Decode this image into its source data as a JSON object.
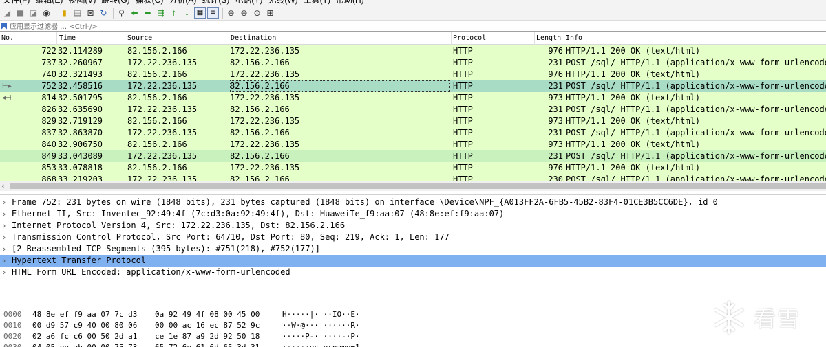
{
  "menu": {
    "items": [
      "文件(F)",
      "编辑(E)",
      "视图(V)",
      "跳转(G)",
      "捕获(C)",
      "分析(A)",
      "统计(S)",
      "电话(Y)",
      "无线(W)",
      "工具(T)",
      "帮助(H)"
    ]
  },
  "toolbar": {
    "buttons": [
      {
        "icon": "shark-fin-start-icon",
        "glyph": "◢",
        "tone": "gray"
      },
      {
        "icon": "stop-square-icon",
        "glyph": "■",
        "tone": "gray"
      },
      {
        "icon": "restart-capture-icon",
        "glyph": "◪",
        "tone": "gray"
      },
      {
        "icon": "capture-options-icon",
        "glyph": "◉",
        "tone": "dark"
      },
      {
        "sep": true
      },
      {
        "icon": "open-file-icon",
        "glyph": "▮",
        "tone": "yellow"
      },
      {
        "icon": "save-file-icon",
        "glyph": "▤",
        "tone": "gray"
      },
      {
        "icon": "close-file-icon",
        "glyph": "⊠",
        "tone": "dark"
      },
      {
        "icon": "reload-file-icon",
        "glyph": "↻",
        "tone": "blue"
      },
      {
        "sep": true
      },
      {
        "icon": "find-packet-icon",
        "glyph": "⚲",
        "tone": "dark"
      },
      {
        "icon": "go-back-icon",
        "glyph": "⬅",
        "tone": "green"
      },
      {
        "icon": "go-forward-icon",
        "glyph": "➡",
        "tone": "green"
      },
      {
        "icon": "go-to-packet-icon",
        "glyph": "⇶",
        "tone": "green"
      },
      {
        "icon": "first-packet-icon",
        "glyph": "⤒",
        "tone": "green"
      },
      {
        "icon": "last-packet-icon",
        "glyph": "⤓",
        "tone": "green"
      },
      {
        "icon": "auto-scroll-icon",
        "glyph": "▦",
        "tone": "box"
      },
      {
        "icon": "colorize-icon",
        "glyph": "≡",
        "tone": "box"
      },
      {
        "sep": true
      },
      {
        "icon": "zoom-in-icon",
        "glyph": "⊕",
        "tone": "dark"
      },
      {
        "icon": "zoom-out-icon",
        "glyph": "⊖",
        "tone": "dark"
      },
      {
        "icon": "zoom-normal-icon",
        "glyph": "⊙",
        "tone": "dark"
      },
      {
        "icon": "resize-columns-icon",
        "glyph": "⊞",
        "tone": "dark"
      }
    ]
  },
  "filter": {
    "placeholder": "应用显示过滤器 … <Ctrl-/>"
  },
  "packet_list": {
    "columns": [
      "No.",
      "Time",
      "Source",
      "Destination",
      "Protocol",
      "Length",
      "Info"
    ],
    "sort_indicator": "^",
    "rows": [
      {
        "no": "722",
        "time": "32.114289",
        "src": "82.156.2.166",
        "dst": "172.22.236.135",
        "proto": "HTTP",
        "len": "976",
        "info": "HTTP/1.1 200 OK  (text/html)",
        "bg": "#e4ffc7",
        "mark": ""
      },
      {
        "no": "737",
        "time": "32.260967",
        "src": "172.22.236.135",
        "dst": "82.156.2.166",
        "proto": "HTTP",
        "len": "231",
        "info": "POST /sql/ HTTP/1.1  (application/x-www-form-urlencoded)",
        "bg": "#e4ffc7",
        "mark": ""
      },
      {
        "no": "740",
        "time": "32.321493",
        "src": "82.156.2.166",
        "dst": "172.22.236.135",
        "proto": "HTTP",
        "len": "976",
        "info": "HTTP/1.1 200 OK  (text/html)",
        "bg": "#e4ffc7",
        "mark": ""
      },
      {
        "no": "752",
        "time": "32.458516",
        "src": "172.22.236.135",
        "dst": "82.156.2.166",
        "proto": "HTTP",
        "len": "231",
        "info": "POST /sql/ HTTP/1.1  (application/x-www-form-urlencoded)",
        "bg": "#a8dcc4",
        "mark": "⊢▸"
      },
      {
        "no": "814",
        "time": "32.501795",
        "src": "82.156.2.166",
        "dst": "172.22.236.135",
        "proto": "HTTP",
        "len": "973",
        "info": "HTTP/1.1 200 OK  (text/html)",
        "bg": "#e4ffc7",
        "mark": "◂⊣"
      },
      {
        "no": "826",
        "time": "32.635690",
        "src": "172.22.236.135",
        "dst": "82.156.2.166",
        "proto": "HTTP",
        "len": "231",
        "info": "POST /sql/ HTTP/1.1  (application/x-www-form-urlencoded)",
        "bg": "#e4ffc7",
        "mark": ""
      },
      {
        "no": "829",
        "time": "32.719129",
        "src": "82.156.2.166",
        "dst": "172.22.236.135",
        "proto": "HTTP",
        "len": "973",
        "info": "HTTP/1.1 200 OK  (text/html)",
        "bg": "#e4ffc7",
        "mark": ""
      },
      {
        "no": "837",
        "time": "32.863870",
        "src": "172.22.236.135",
        "dst": "82.156.2.166",
        "proto": "HTTP",
        "len": "231",
        "info": "POST /sql/ HTTP/1.1  (application/x-www-form-urlencoded)",
        "bg": "#e4ffc7",
        "mark": ""
      },
      {
        "no": "840",
        "time": "32.906750",
        "src": "82.156.2.166",
        "dst": "172.22.236.135",
        "proto": "HTTP",
        "len": "973",
        "info": "HTTP/1.1 200 OK  (text/html)",
        "bg": "#e4ffc7",
        "mark": ""
      },
      {
        "no": "849",
        "time": "33.043089",
        "src": "172.22.236.135",
        "dst": "82.156.2.166",
        "proto": "HTTP",
        "len": "231",
        "info": "POST /sql/ HTTP/1.1  (application/x-www-form-urlencoded)",
        "bg": "#c9f1bd",
        "mark": ""
      },
      {
        "no": "853",
        "time": "33.078818",
        "src": "82.156.2.166",
        "dst": "172.22.236.135",
        "proto": "HTTP",
        "len": "976",
        "info": "HTTP/1.1 200 OK  (text/html)",
        "bg": "#e4ffc7",
        "mark": ""
      },
      {
        "no": "868",
        "time": "33.219203",
        "src": "172.22.236.135",
        "dst": "82.156.2.166",
        "proto": "HTTP",
        "len": "230",
        "info": "POST /sql/ HTTP/1.1  (application/x-www-form-urlencoded)",
        "bg": "#e4ffc7",
        "mark": ""
      }
    ]
  },
  "details": {
    "rows": [
      {
        "text": "Frame 752: 231 bytes on wire (1848 bits), 231 bytes captured (1848 bits) on interface \\Device\\NPF_{A013FF2A-6FB5-45B2-83F4-01CE3B5CC6DE}, id 0",
        "selected": false
      },
      {
        "text": "Ethernet II, Src: Inventec_92:49:4f (7c:d3:0a:92:49:4f), Dst: HuaweiTe_f9:aa:07 (48:8e:ef:f9:aa:07)",
        "selected": false
      },
      {
        "text": "Internet Protocol Version 4, Src: 172.22.236.135, Dst: 82.156.2.166",
        "selected": false
      },
      {
        "text": "Transmission Control Protocol, Src Port: 64710, Dst Port: 80, Seq: 219, Ack: 1, Len: 177",
        "selected": false
      },
      {
        "text": "[2 Reassembled TCP Segments (395 bytes): #751(218), #752(177)]",
        "selected": false
      },
      {
        "text": "Hypertext Transfer Protocol",
        "selected": true
      },
      {
        "text": "HTML Form URL Encoded: application/x-www-form-urlencoded",
        "selected": false
      }
    ]
  },
  "bytes": {
    "rows": [
      {
        "offset": "0000",
        "hex1": "48 8e ef f9 aa 07 7c d3",
        "hex2": "0a 92 49 4f 08 00 45 00",
        "ascii": "H·····|· ··IO··E·"
      },
      {
        "offset": "0010",
        "hex1": "00 d9 57 c9 40 00 80 06",
        "hex2": "00 00 ac 16 ec 87 52 9c",
        "ascii": "··W·@··· ······R·"
      },
      {
        "offset": "0020",
        "hex1": "02 a6 fc c6 00 50 2d a1",
        "hex2": "ce 1e 87 a9 2d 92 50 18",
        "ascii": "·····P-· ····-·P·"
      },
      {
        "offset": "0030",
        "hex1": "04 05 ee ab 00 00 75 73",
        "hex2": "65 72 6e 61 6d 65 3d 31",
        "ascii": "······us ername=1"
      }
    ]
  },
  "watermark": {
    "text": "看雪"
  },
  "colors": {
    "row_green": "#e4ffc7",
    "row_selected": "#a8dcc4",
    "detail_selected": "#7fb0f0"
  }
}
